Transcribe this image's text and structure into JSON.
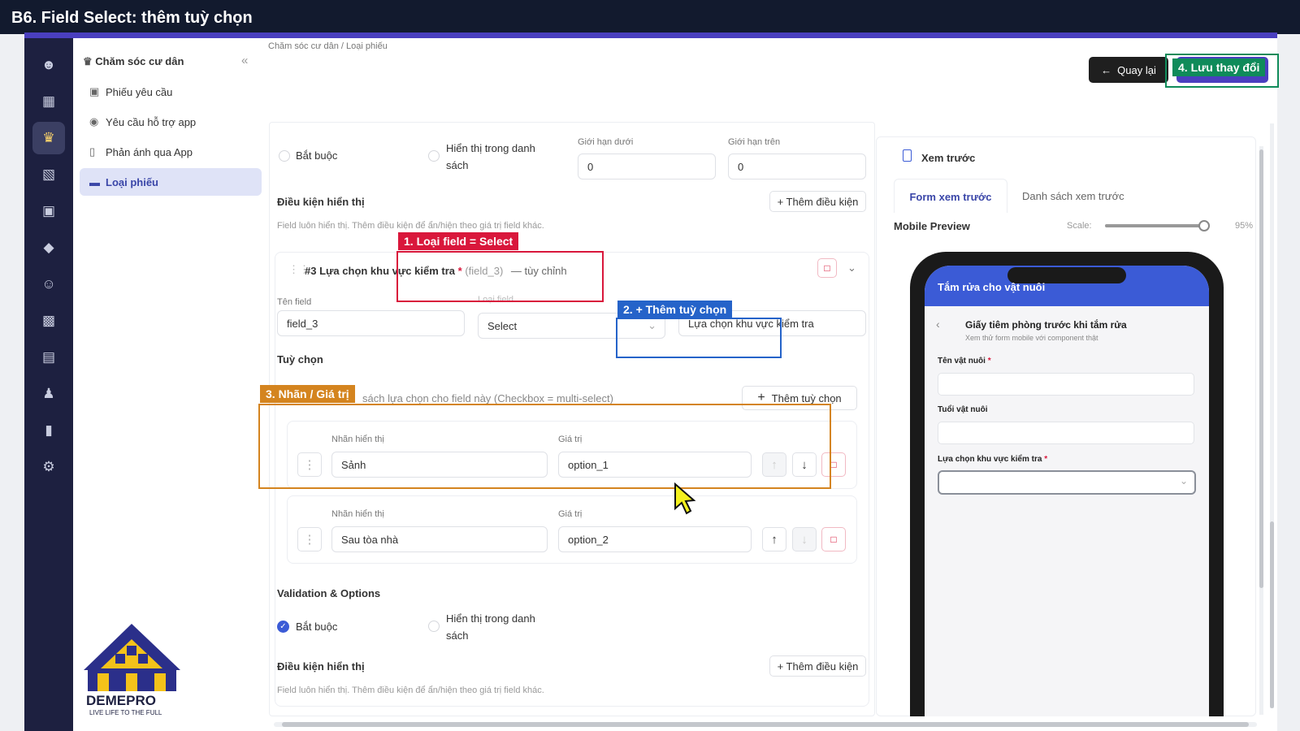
{
  "title": "B6. Field Select: thêm tuỳ chọn",
  "sidebar": {
    "header": "Chăm sóc cư dân",
    "items": [
      {
        "label": "Phiếu yêu cầu"
      },
      {
        "label": "Yêu cầu hỗ trợ app"
      },
      {
        "label": "Phản ánh qua App"
      },
      {
        "label": "Loại phiếu"
      }
    ]
  },
  "breadcrumb": {
    "parent": "Chăm sóc cư dân",
    "sep": "/",
    "current": "Loại phiếu"
  },
  "topbar": {
    "back": "Quay lại",
    "save": "4. Lưu thay đổi"
  },
  "prev_field": {
    "required": "Bắt buộc",
    "show_in_list_1": "Hiển thị trong danh",
    "show_in_list_2": "sách",
    "lower_label": "Giới hạn dưới",
    "lower": "0",
    "upper_label": "Giới hạn trên",
    "upper": "0",
    "cond_title": "Điều kiện hiển thị",
    "add_cond": "+ Thêm điều kiện",
    "cond_hint": "Field luôn hiển thị. Thêm điều kiện để ẩn/hiện theo giá trị field khác."
  },
  "field3": {
    "header": "#3 Lựa chọn khu vực kiểm tra",
    "star": "*",
    "code": "(field_3)",
    "custom": "— tùy chỉnh",
    "name_label": "Tên field",
    "name": "field_3",
    "type_label": "Loại field",
    "type": "Select",
    "display": "Lựa chọn khu vực kiểm tra",
    "options_title": "Tuỳ chọn",
    "options_hint": "sách lựa chọn cho field này (Checkbox = multi-select)",
    "add_option": "Thêm tuỳ chọn",
    "options": [
      {
        "label_title": "Nhãn hiển thị",
        "label": "Sảnh",
        "value_title": "Giá trị",
        "value": "option_1"
      },
      {
        "label_title": "Nhãn hiển thị",
        "label": "Sau tòa nhà",
        "value_title": "Giá trị",
        "value": "option_2"
      }
    ],
    "validation_title": "Validation & Options",
    "required": "Bắt buộc",
    "show_in_list_1": "Hiển thị trong danh",
    "show_in_list_2": "sách",
    "cond_title": "Điều kiện hiển thị",
    "add_cond": "+ Thêm điều kiện",
    "cond_hint": "Field luôn hiển thị. Thêm điều kiện để ẩn/hiện theo giá trị field khác."
  },
  "preview": {
    "title": "Xem trước",
    "tab_form": "Form xem trước",
    "tab_list": "Danh sách xem trước",
    "mobile": "Mobile Preview",
    "scale_label": "Scale:",
    "scale": "95%",
    "scale_value": 0.95,
    "phone": {
      "header": "Tắm rửa cho vật nuôi",
      "form_title": "Giấy tiêm phòng trước khi tắm rửa",
      "form_sub": "Xem thử form mobile với component thật",
      "f1": "Tên vật nuôi",
      "f2": "Tuổi vật nuôi",
      "f3": "Lựa chọn khu vực kiểm tra",
      "star": "*"
    }
  },
  "annotations": {
    "a1": "1. Loại field = Select",
    "a2": "2. + Thêm tuỳ chọn",
    "a3": "3. Nhãn / Giá trị"
  },
  "logo": {
    "name": "DEMEPRO",
    "tagline": "LIVE LIFE TO THE FULL"
  },
  "colors": {
    "annot_red": "#d9173b",
    "annot_blue": "#2563c9",
    "annot_orange": "#d4841f",
    "annot_green": "#0f8b5a",
    "nav_dark": "#1d2040"
  }
}
